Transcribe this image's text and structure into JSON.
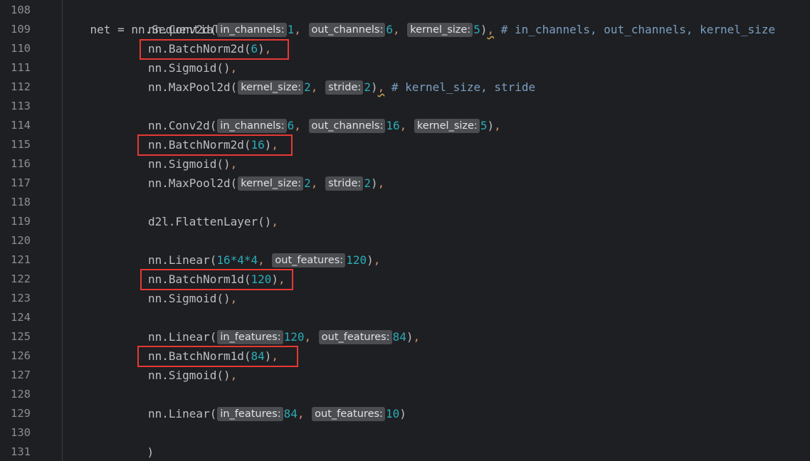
{
  "gutter": {
    "line_numbers": [
      "108",
      "109",
      "110",
      "111",
      "112",
      "113",
      "114",
      "115",
      "116",
      "117",
      "118",
      "119",
      "120",
      "121",
      "122",
      "123",
      "124",
      "125",
      "126",
      "127",
      "128",
      "129",
      "130",
      "131"
    ]
  },
  "code": {
    "l108": {
      "text": "net = nn.Sequential("
    },
    "l109": {
      "fn": "nn.Conv2d(",
      "h1": "in_channels:",
      "v1": "1",
      "c1": ",",
      "h2": "out_channels:",
      "v2": "6",
      "c2": ",",
      "h3": "kernel_size:",
      "v3": "5",
      "close": ")",
      "c3": ",",
      "comment": "# in_channels, out_channels, kernel_size"
    },
    "l110": {
      "fn": "nn.BatchNorm2d(",
      "v": "6",
      "close": ")",
      "c": ","
    },
    "l111": {
      "fn": "nn.Sigmoid()",
      "c": ","
    },
    "l112": {
      "fn": "nn.MaxPool2d(",
      "h1": "kernel_size:",
      "v1": "2",
      "c1": ",",
      "h2": "stride:",
      "v2": "2",
      "close": ")",
      "c2": ",",
      "comment": "# kernel_size, stride"
    },
    "l114": {
      "fn": "nn.Conv2d(",
      "h1": "in_channels:",
      "v1": "6",
      "c1": ",",
      "h2": "out_channels:",
      "v2": "16",
      "c2": ",",
      "h3": "kernel_size:",
      "v3": "5",
      "close": ")",
      "c3": ","
    },
    "l115": {
      "fn": "nn.BatchNorm2d(",
      "v": "16",
      "close": ")",
      "c": ","
    },
    "l116": {
      "fn": "nn.Sigmoid()",
      "c": ","
    },
    "l117": {
      "fn": "nn.MaxPool2d(",
      "h1": "kernel_size:",
      "v1": "2",
      "c1": ",",
      "h2": "stride:",
      "v2": "2",
      "close": ")",
      "c2": ","
    },
    "l119": {
      "fn": "d2l.FlattenLayer()",
      "c": ","
    },
    "l121": {
      "fn": "nn.Linear(",
      "v1": "16*4*4",
      "c1": ",",
      "h2": "out_features:",
      "v2": "120",
      "close": ")",
      "c2": ","
    },
    "l122": {
      "fn": "nn.BatchNorm1d(",
      "v": "120",
      "close": ")",
      "c": ","
    },
    "l123": {
      "fn": "nn.Sigmoid()",
      "c": ","
    },
    "l125": {
      "fn": "nn.Linear(",
      "h1": "in_features:",
      "v1": "120",
      "c1": ",",
      "h2": "out_features:",
      "v2": "84",
      "close": ")",
      "c2": ","
    },
    "l126": {
      "fn": "nn.BatchNorm1d(",
      "v": "84",
      "close": ")",
      "c": ","
    },
    "l127": {
      "fn": "nn.Sigmoid()",
      "c": ","
    },
    "l129": {
      "fn": "nn.Linear(",
      "h1": "in_features:",
      "v1": "84",
      "c1": ",",
      "h2": "out_features:",
      "v2": "10",
      "close": ")"
    },
    "l130": {
      "text": ")"
    }
  },
  "colors": {
    "background": "#1e1f22",
    "text": "#bcbec4",
    "number": "#2aacb8",
    "comma": "#cf8e6d",
    "comment": "#7a9ec2",
    "hint_bg": "#4b4d50",
    "highlight_box": "#e53935"
  }
}
